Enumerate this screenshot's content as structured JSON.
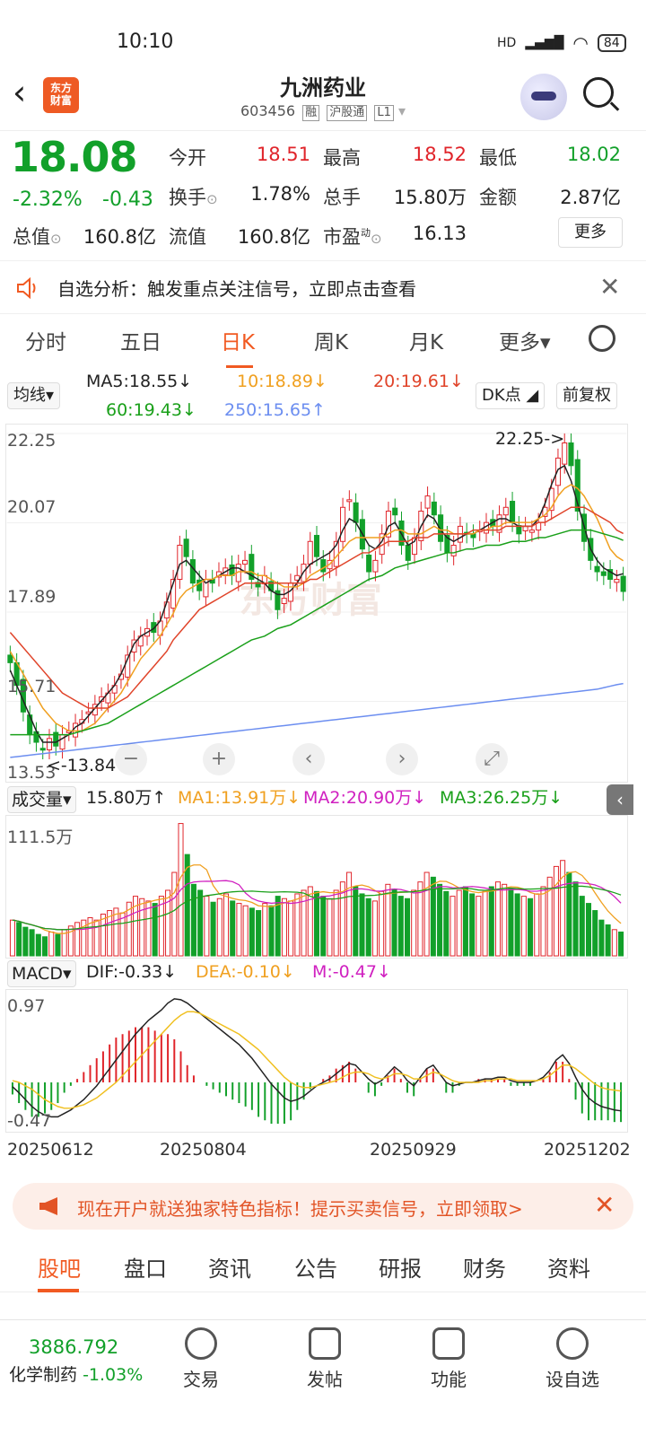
{
  "status": {
    "time": "10:10",
    "network": "HD",
    "battery": "84"
  },
  "header": {
    "brand": "东方\n财富",
    "title": "九洲药业",
    "code": "603456",
    "tags": [
      "融",
      "沪股通",
      "L1"
    ]
  },
  "quote": {
    "price": "18.08",
    "pct": "-2.32%",
    "change": "-0.43",
    "rows": [
      [
        {
          "l": "今开",
          "v": "18.51"
        },
        {
          "l": "最高",
          "v": "18.52"
        },
        {
          "l": "最低",
          "v": "18.02"
        }
      ],
      [
        {
          "l": "换手",
          "v": "1.78%"
        },
        {
          "l": "总手",
          "v": "15.80万"
        },
        {
          "l": "金额",
          "v": "2.87亿"
        }
      ],
      [
        {
          "l": "总值",
          "v": "160.8亿"
        },
        {
          "l": "流值",
          "v": "160.8亿"
        },
        {
          "l": "市盈",
          "v": "16.13"
        }
      ]
    ],
    "more": "更多"
  },
  "analysis": {
    "text": "自选分析：触发重点关注信号，立即点击查看"
  },
  "ktabs": [
    "分时",
    "五日",
    "日K",
    "周K",
    "月K",
    "更多▾"
  ],
  "ma": {
    "selector": "均线▾",
    "ma5": "MA5:18.55↓",
    "ma10": "10:18.89↓",
    "ma20": "20:19.61↓",
    "ma60": "60:19.43↓",
    "ma250": "250:15.65↑",
    "dk": "DK点",
    "fq": "前复权",
    "colors": {
      "ma5": "#222222",
      "ma10": "#f0a020",
      "ma20": "#e0442a",
      "ma60": "#1aa01a",
      "ma250": "#6c8ef0"
    }
  },
  "chart_data": {
    "type": "candlestick",
    "yticks": [
      "22.25",
      "20.07",
      "17.89",
      "15.71",
      "13.53"
    ],
    "high_label": "22.25->",
    "low_label": "<-13.84",
    "watermark": "东方财富",
    "ylim": [
      13.53,
      22.25
    ],
    "series_close": [
      16.2,
      15.6,
      14.9,
      14.3,
      14.1,
      13.9,
      14.2,
      14.0,
      14.3,
      14.4,
      14.6,
      14.7,
      14.9,
      15.1,
      15.3,
      15.4,
      15.6,
      15.9,
      16.4,
      16.8,
      16.9,
      17.1,
      17.0,
      17.3,
      17.8,
      18.4,
      19.3,
      19.0,
      18.3,
      18.1,
      18.4,
      18.3,
      18.6,
      18.7,
      18.5,
      18.8,
      18.9,
      18.4,
      18.2,
      18.5,
      18.1,
      17.6,
      17.9,
      18.3,
      18.5,
      18.8,
      19.4,
      19.0,
      18.6,
      18.9,
      19.4,
      20.3,
      20.5,
      19.9,
      19.2,
      18.6,
      18.9,
      19.6,
      20.2,
      20.1,
      19.3,
      18.9,
      19.5,
      20.2,
      20.6,
      20.1,
      19.4,
      19.1,
      19.3,
      19.8,
      19.6,
      19.5,
      19.7,
      19.9,
      19.8,
      20.1,
      20.3,
      19.9,
      19.6,
      19.8,
      19.7,
      19.9,
      20.3,
      20.8,
      21.6,
      22.0,
      21.4,
      20.2,
      19.4,
      18.9,
      18.6,
      18.5,
      18.4,
      18.4,
      18.08
    ],
    "ma_series": {
      "ma5": [
        16.0,
        15.6,
        15.2,
        14.8,
        14.4,
        14.1,
        14.1,
        14.1,
        14.2,
        14.3,
        14.5,
        14.6,
        14.8,
        15.0,
        15.2,
        15.4,
        15.6,
        15.9,
        16.3,
        16.7,
        16.9,
        17.0,
        17.1,
        17.3,
        17.8,
        18.3,
        18.8,
        18.9,
        18.7,
        18.5,
        18.3,
        18.4,
        18.5,
        18.6,
        18.7,
        18.7,
        18.6,
        18.5,
        18.4,
        18.3,
        18.1,
        18.0,
        18.0,
        18.1,
        18.3,
        18.6,
        18.8,
        18.9,
        19.0,
        19.1,
        19.3,
        19.7,
        20.0,
        19.9,
        19.6,
        19.3,
        19.2,
        19.4,
        19.8,
        19.9,
        19.6,
        19.3,
        19.4,
        19.8,
        20.1,
        20.0,
        19.7,
        19.5,
        19.4,
        19.5,
        19.6,
        19.6,
        19.7,
        19.8,
        19.9,
        20.0,
        20.0,
        19.9,
        19.8,
        19.8,
        19.8,
        20.0,
        20.4,
        20.9,
        21.3,
        21.4,
        21.0,
        20.4,
        19.8,
        19.2,
        18.9,
        18.7,
        18.6,
        18.5,
        18.55
      ],
      "ma10": [
        16.5,
        16.2,
        15.9,
        15.6,
        15.3,
        15.0,
        14.8,
        14.6,
        14.5,
        14.4,
        14.4,
        14.4,
        14.5,
        14.6,
        14.8,
        15.0,
        15.2,
        15.4,
        15.7,
        16.0,
        16.3,
        16.5,
        16.7,
        16.9,
        17.2,
        17.5,
        17.9,
        18.1,
        18.2,
        18.3,
        18.4,
        18.4,
        18.5,
        18.5,
        18.5,
        18.6,
        18.6,
        18.6,
        18.5,
        18.5,
        18.4,
        18.3,
        18.2,
        18.2,
        18.2,
        18.3,
        18.5,
        18.6,
        18.7,
        18.8,
        19.0,
        19.2,
        19.4,
        19.5,
        19.5,
        19.5,
        19.5,
        19.5,
        19.6,
        19.7,
        19.7,
        19.6,
        19.6,
        19.6,
        19.7,
        19.8,
        19.7,
        19.7,
        19.6,
        19.6,
        19.6,
        19.6,
        19.7,
        19.7,
        19.8,
        19.8,
        19.9,
        19.9,
        19.9,
        19.9,
        19.9,
        20.0,
        20.1,
        20.3,
        20.6,
        20.8,
        20.9,
        20.8,
        20.6,
        20.3,
        20.0,
        19.6,
        19.2,
        19.0,
        18.89
      ],
      "ma20": [
        17.0,
        16.8,
        16.6,
        16.4,
        16.2,
        16.0,
        15.8,
        15.6,
        15.4,
        15.3,
        15.2,
        15.1,
        15.0,
        15.0,
        15.0,
        15.0,
        15.1,
        15.2,
        15.3,
        15.5,
        15.7,
        15.9,
        16.1,
        16.3,
        16.5,
        16.8,
        17.0,
        17.2,
        17.4,
        17.6,
        17.7,
        17.8,
        17.9,
        18.0,
        18.1,
        18.2,
        18.3,
        18.3,
        18.3,
        18.3,
        18.3,
        18.3,
        18.3,
        18.3,
        18.3,
        18.3,
        18.4,
        18.4,
        18.5,
        18.6,
        18.7,
        18.8,
        18.9,
        19.0,
        19.1,
        19.1,
        19.2,
        19.3,
        19.4,
        19.4,
        19.4,
        19.4,
        19.5,
        19.5,
        19.5,
        19.6,
        19.6,
        19.6,
        19.6,
        19.6,
        19.6,
        19.7,
        19.7,
        19.7,
        19.7,
        19.7,
        19.8,
        19.8,
        19.8,
        19.8,
        19.8,
        19.9,
        19.9,
        20.0,
        20.1,
        20.2,
        20.3,
        20.3,
        20.3,
        20.2,
        20.1,
        20.0,
        19.9,
        19.7,
        19.61
      ],
      "ma60": [
        14.3,
        14.3,
        14.3,
        14.3,
        14.3,
        14.3,
        14.3,
        14.3,
        14.3,
        14.3,
        14.35,
        14.4,
        14.45,
        14.5,
        14.55,
        14.6,
        14.7,
        14.8,
        14.9,
        15.0,
        15.1,
        15.2,
        15.3,
        15.4,
        15.5,
        15.6,
        15.7,
        15.8,
        15.9,
        16.0,
        16.1,
        16.2,
        16.3,
        16.4,
        16.5,
        16.6,
        16.7,
        16.8,
        16.85,
        16.9,
        17.0,
        17.1,
        17.15,
        17.2,
        17.3,
        17.4,
        17.5,
        17.6,
        17.7,
        17.8,
        17.9,
        18.0,
        18.1,
        18.2,
        18.3,
        18.4,
        18.45,
        18.5,
        18.6,
        18.7,
        18.75,
        18.8,
        18.85,
        18.9,
        18.95,
        19.0,
        19.05,
        19.1,
        19.1,
        19.15,
        19.2,
        19.2,
        19.25,
        19.3,
        19.3,
        19.3,
        19.35,
        19.4,
        19.4,
        19.4,
        19.45,
        19.5,
        19.5,
        19.55,
        19.6,
        19.65,
        19.7,
        19.7,
        19.7,
        19.7,
        19.65,
        19.6,
        19.55,
        19.5,
        19.43
      ],
      "ma250": [
        13.7,
        13.72,
        13.74,
        13.76,
        13.78,
        13.8,
        13.82,
        13.84,
        13.86,
        13.88,
        13.9,
        13.92,
        13.94,
        13.96,
        13.98,
        14.0,
        14.02,
        14.04,
        14.06,
        14.08,
        14.1,
        14.12,
        14.14,
        14.16,
        14.18,
        14.2,
        14.22,
        14.24,
        14.26,
        14.28,
        14.3,
        14.32,
        14.34,
        14.36,
        14.38,
        14.4,
        14.42,
        14.44,
        14.46,
        14.48,
        14.5,
        14.52,
        14.54,
        14.56,
        14.58,
        14.6,
        14.62,
        14.64,
        14.66,
        14.68,
        14.7,
        14.72,
        14.74,
        14.76,
        14.78,
        14.8,
        14.82,
        14.84,
        14.86,
        14.88,
        14.9,
        14.92,
        14.94,
        14.96,
        14.98,
        15.0,
        15.02,
        15.04,
        15.06,
        15.08,
        15.1,
        15.12,
        15.14,
        15.16,
        15.18,
        15.2,
        15.22,
        15.24,
        15.26,
        15.28,
        15.3,
        15.32,
        15.34,
        15.36,
        15.38,
        15.4,
        15.42,
        15.44,
        15.46,
        15.48,
        15.5,
        15.54,
        15.58,
        15.62,
        15.65
      ]
    },
    "volume": {
      "label": "成交量▾",
      "current": "15.80万↑",
      "ma1": "MA1:13.91万↓",
      "ma2": "MA2:20.90万↓",
      "ma3": "MA3:26.25万↓",
      "top": "111.5万",
      "values": [
        30,
        28,
        24,
        22,
        18,
        16,
        20,
        18,
        22,
        25,
        28,
        30,
        32,
        30,
        35,
        38,
        40,
        36,
        45,
        50,
        48,
        46,
        44,
        50,
        55,
        70,
        111,
        85,
        60,
        55,
        50,
        45,
        48,
        52,
        46,
        44,
        42,
        40,
        38,
        44,
        42,
        50,
        48,
        46,
        52,
        55,
        58,
        54,
        50,
        48,
        55,
        62,
        70,
        58,
        52,
        48,
        46,
        54,
        60,
        56,
        50,
        48,
        55,
        62,
        70,
        66,
        60,
        54,
        50,
        55,
        58,
        52,
        50,
        54,
        58,
        62,
        60,
        56,
        52,
        50,
        48,
        52,
        58,
        66,
        75,
        80,
        70,
        62,
        50,
        44,
        38,
        30,
        26,
        22,
        20
      ]
    },
    "macd": {
      "label": "MACD▾",
      "dif": "DIF:-0.33↓",
      "dea": "DEA:-0.10↓",
      "m": "M:-0.47↓",
      "top": "0.97",
      "bottom": "-0.47",
      "dif_series": [
        -0.05,
        -0.12,
        -0.2,
        -0.28,
        -0.34,
        -0.38,
        -0.4,
        -0.4,
        -0.36,
        -0.32,
        -0.26,
        -0.2,
        -0.12,
        -0.04,
        0.06,
        0.16,
        0.26,
        0.36,
        0.46,
        0.56,
        0.64,
        0.72,
        0.78,
        0.84,
        0.92,
        0.97,
        0.96,
        0.92,
        0.86,
        0.8,
        0.74,
        0.68,
        0.62,
        0.56,
        0.5,
        0.44,
        0.36,
        0.28,
        0.18,
        0.08,
        -0.02,
        -0.1,
        -0.18,
        -0.22,
        -0.2,
        -0.16,
        -0.1,
        -0.04,
        0.0,
        0.04,
        0.1,
        0.16,
        0.22,
        0.2,
        0.12,
        0.04,
        -0.02,
        0.02,
        0.1,
        0.18,
        0.12,
        0.02,
        -0.04,
        0.06,
        0.16,
        0.2,
        0.1,
        0.0,
        -0.04,
        -0.02,
        0.0,
        0.0,
        0.02,
        0.04,
        0.04,
        0.06,
        0.06,
        0.02,
        0.0,
        0.0,
        0.0,
        0.02,
        0.06,
        0.14,
        0.26,
        0.32,
        0.22,
        0.06,
        -0.08,
        -0.18,
        -0.24,
        -0.28,
        -0.3,
        -0.32,
        -0.33
      ],
      "dea_series": [
        0.02,
        0.0,
        -0.04,
        -0.08,
        -0.14,
        -0.2,
        -0.24,
        -0.28,
        -0.3,
        -0.3,
        -0.28,
        -0.26,
        -0.22,
        -0.18,
        -0.12,
        -0.06,
        0.0,
        0.08,
        0.16,
        0.24,
        0.32,
        0.4,
        0.48,
        0.56,
        0.64,
        0.72,
        0.78,
        0.82,
        0.82,
        0.8,
        0.76,
        0.72,
        0.68,
        0.64,
        0.6,
        0.56,
        0.5,
        0.44,
        0.38,
        0.3,
        0.22,
        0.14,
        0.06,
        0.0,
        -0.04,
        -0.06,
        -0.06,
        -0.04,
        -0.02,
        0.0,
        0.02,
        0.06,
        0.1,
        0.12,
        0.12,
        0.1,
        0.06,
        0.04,
        0.06,
        0.1,
        0.1,
        0.08,
        0.04,
        0.04,
        0.08,
        0.12,
        0.1,
        0.06,
        0.02,
        0.0,
        0.0,
        0.0,
        0.0,
        0.02,
        0.02,
        0.04,
        0.04,
        0.04,
        0.02,
        0.02,
        0.02,
        0.02,
        0.04,
        0.08,
        0.14,
        0.2,
        0.2,
        0.16,
        0.1,
        0.04,
        -0.02,
        -0.06,
        -0.08,
        -0.09,
        -0.1
      ]
    },
    "dates": [
      "20250612",
      "20250804",
      "20250929",
      "20251202"
    ]
  },
  "promo": {
    "text": "现在开户就送独家特色指标！提示买卖信号，立即领取>"
  },
  "btabs": [
    "股吧",
    "盘口",
    "资讯",
    "公告",
    "研报",
    "财务",
    "资料"
  ],
  "footer": {
    "index_value": "3886.792",
    "index_name": "化学制药",
    "index_pct": "-1.03%",
    "nav": [
      "交易",
      "发帖",
      "功能",
      "设自选"
    ]
  }
}
